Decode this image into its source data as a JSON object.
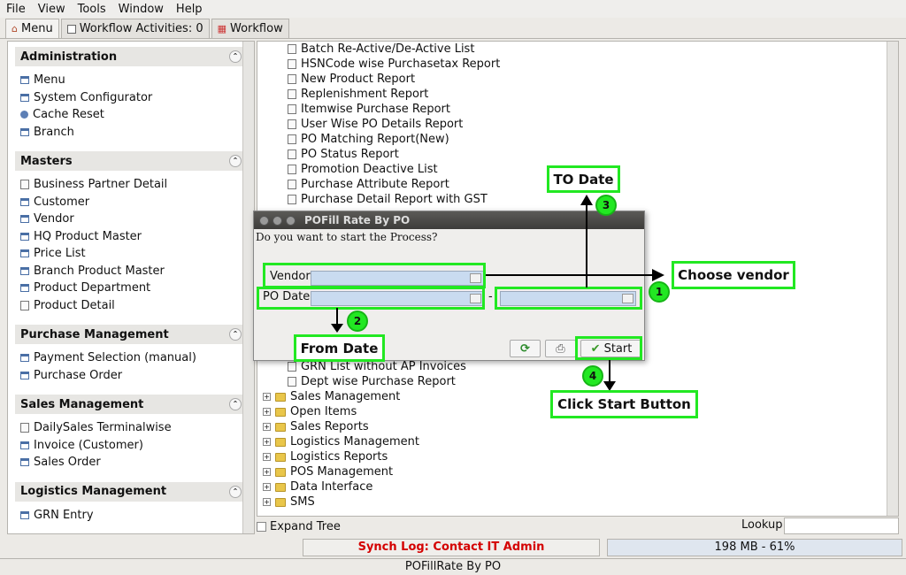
{
  "menubar": {
    "items": [
      "File",
      "View",
      "Tools",
      "Window",
      "Help"
    ]
  },
  "tabs": [
    {
      "label": "Menu",
      "active": true
    },
    {
      "label": "Workflow Activities: 0",
      "active": false
    },
    {
      "label": "Workflow",
      "active": false
    }
  ],
  "sidebar": {
    "sections": [
      {
        "title": "Administration",
        "items": [
          {
            "label": "Menu",
            "icon": "window-icon"
          },
          {
            "label": "System Configurator",
            "icon": "window-icon"
          },
          {
            "label": "Cache Reset",
            "icon": "process-icon"
          },
          {
            "label": "Branch",
            "icon": "window-icon"
          }
        ]
      },
      {
        "title": "Masters",
        "items": [
          {
            "label": "Business Partner Detail",
            "icon": "document-icon"
          },
          {
            "label": "Customer",
            "icon": "window-icon"
          },
          {
            "label": "Vendor",
            "icon": "window-icon"
          },
          {
            "label": "HQ Product Master",
            "icon": "window-icon"
          },
          {
            "label": "Price List",
            "icon": "window-icon"
          },
          {
            "label": "Branch Product Master",
            "icon": "window-icon"
          },
          {
            "label": "Product Department",
            "icon": "window-icon"
          },
          {
            "label": "Product Detail",
            "icon": "document-icon"
          }
        ]
      },
      {
        "title": "Purchase Management",
        "items": [
          {
            "label": "Payment Selection (manual)",
            "icon": "window-icon"
          },
          {
            "label": "Purchase Order",
            "icon": "window-icon"
          }
        ]
      },
      {
        "title": "Sales Management",
        "items": [
          {
            "label": "DailySales Terminalwise",
            "icon": "document-icon"
          },
          {
            "label": "Invoice (Customer)",
            "icon": "window-icon"
          },
          {
            "label": "Sales Order",
            "icon": "window-icon"
          }
        ]
      },
      {
        "title": "Logistics Management",
        "items": [
          {
            "label": "GRN Entry",
            "icon": "window-icon"
          }
        ]
      }
    ]
  },
  "tree": {
    "reports": [
      "Batch Re-Active/De-Active List",
      "HSNCode wise Purchasetax Report",
      "New Product Report",
      "Replenishment Report",
      "Itemwise Purchase Report",
      "User Wise PO Details Report",
      "PO Matching Report(New)",
      "PO Status Report",
      "Promotion Deactive List",
      "Purchase Attribute Report",
      "Purchase Detail Report with GST"
    ],
    "reports_after": [
      "GRN List without AP Invoices",
      "Dept wise Purchase Report"
    ],
    "folders": [
      "Sales Management",
      "Open Items",
      "Sales Reports",
      "Logistics Management",
      "Logistics Reports",
      "POS Management",
      "Data Interface",
      "SMS"
    ]
  },
  "bottom": {
    "expand_tree": "Expand Tree",
    "lookup": "Lookup",
    "synch": "Synch Log: Contact IT Admin",
    "memory": "198 MB - 61%",
    "status": "POFillRate By PO"
  },
  "dialog": {
    "title": "POFill Rate By PO",
    "message": "Do you want to start the Process?",
    "vendor_label": "Vendor",
    "po_date_label": "PO Date",
    "range_sep": "-",
    "start_label": "Start",
    "vendor_value": "",
    "po_date_from": "",
    "po_date_to": ""
  },
  "annotations": {
    "choose_vendor": "Choose vendor",
    "to_date": "TO Date",
    "from_date": "From Date",
    "click_start": "Click Start Button",
    "badge1": "1",
    "badge2": "2",
    "badge3": "3",
    "badge4": "4",
    "color": "#22e822"
  }
}
